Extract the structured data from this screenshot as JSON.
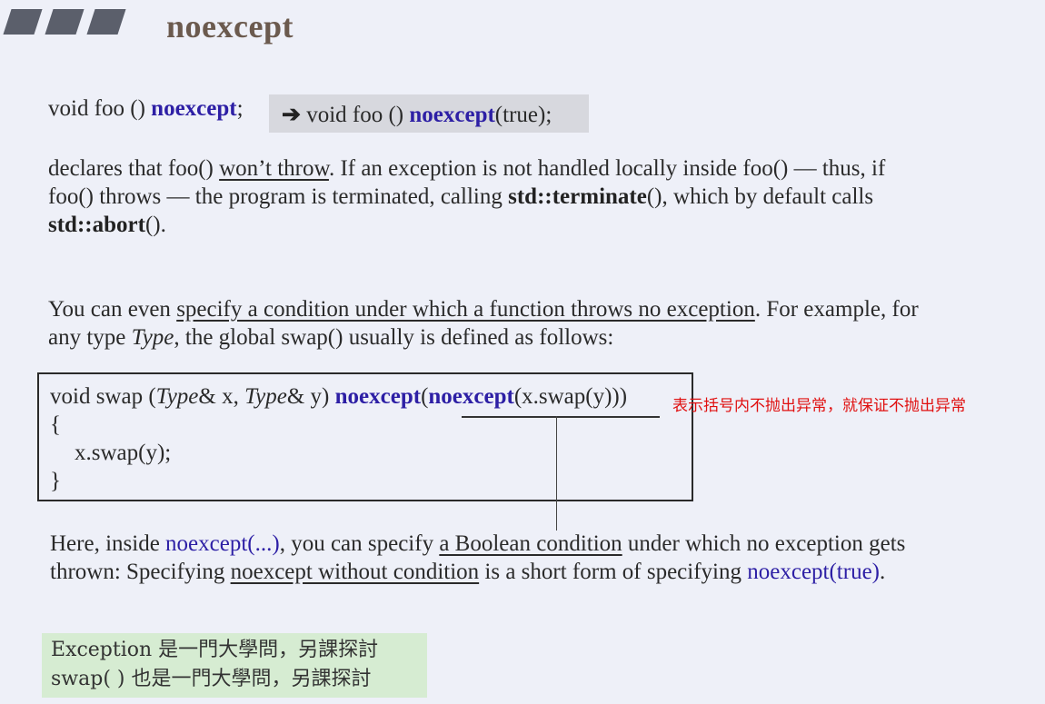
{
  "header": {
    "title": "noexcept"
  },
  "decl": {
    "p1": "void foo () ",
    "kw1": "noexcept",
    "p2": ";",
    "arrow": "➔",
    "p3": " void foo () ",
    "kw2": "noexcept",
    "p4": "(true);"
  },
  "para1": {
    "l1a": "declares that foo() ",
    "l1u": "won’t throw",
    "l1b": ". If an exception is not handled locally inside foo() — thus, if",
    "l2a": "foo() throws — the program is terminated, calling ",
    "l2b": "std::terminate",
    "l2c": "(), which by default calls",
    "l3a": "std::abort",
    "l3b": "()."
  },
  "para2": {
    "l1a": "You can even ",
    "l1u": "specify a condition under which a function throws no exception",
    "l1b": ". For example, for",
    "l2a": "any type ",
    "l2i": "Type",
    "l2b": ", the global swap() usually is defined as follows:"
  },
  "code": {
    "a": "void swap (",
    "t1": "Type",
    "b": "& x, ",
    "t2": "Type",
    "c": "& y) ",
    "kw1": "noexcept",
    "d": "(",
    "kw2": "noexcept",
    "e": "(x.swap(y)))",
    "open": "{",
    "body": "x.swap(y);",
    "close": "}"
  },
  "annotation": "表示括号内不抛出异常，就保证不抛出异常",
  "para3": {
    "l1a": "Here, inside ",
    "l1k": "noexcept(...)",
    "l1b": ", you can specify ",
    "l1u": "a Boolean condition",
    "l1c": " under which no exception gets",
    "l2a": "thrown: Specifying ",
    "l2u": "noexcept without condition",
    "l2b": " is a short form of specifying ",
    "l2k": "noexcept(true)",
    "l2c": "."
  },
  "note": {
    "line1": "Exception 是一門大學問，另課探討",
    "line2": "swap( ) 也是一門大學問，另課探討"
  }
}
